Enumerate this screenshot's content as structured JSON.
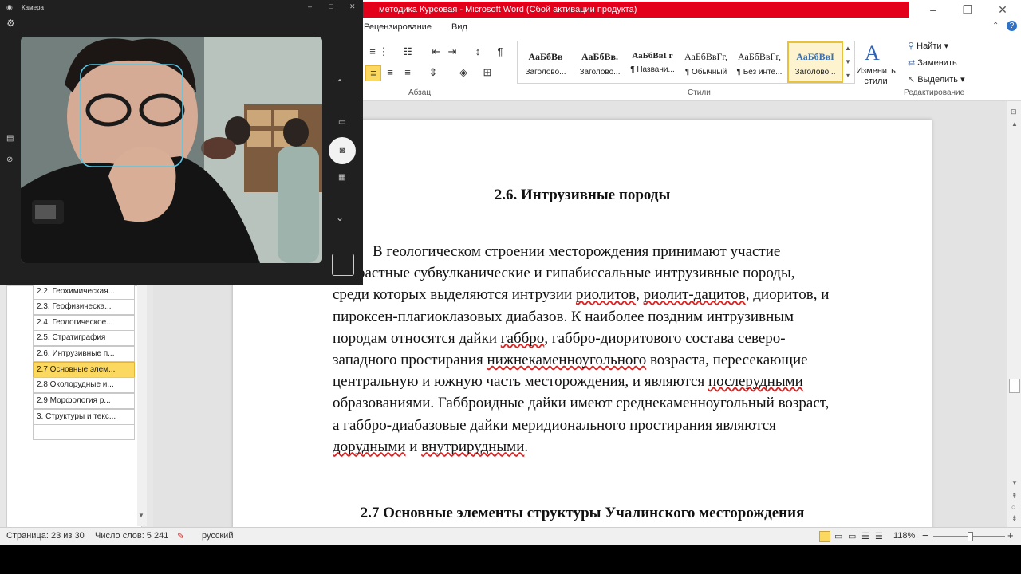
{
  "word": {
    "title": "методика Курсовая - Microsoft Word (Сбой активации продукта)",
    "window_controls": [
      "–",
      "❐",
      "✕"
    ],
    "tabs": [
      "Рецензирование",
      "Вид"
    ],
    "groups": {
      "paragraph": "Абзац",
      "styles": "Стили",
      "editing": "Редактирование"
    },
    "styles": [
      {
        "preview": "АаБбВв",
        "name": "Заголово..."
      },
      {
        "preview": "АаБбВв.",
        "name": "Заголово..."
      },
      {
        "preview": "АаБбВвГг",
        "name": "¶ Названи..."
      },
      {
        "preview": "АаБбВвГг,",
        "name": "¶ Обычный"
      },
      {
        "preview": "АаБбВвГг,",
        "name": "¶ Без инте..."
      },
      {
        "preview": "АаБбВвI",
        "name": "Заголово..."
      }
    ],
    "change_styles": "Изменить стили",
    "editing": {
      "find": "Найти",
      "replace": "Заменить",
      "select": "Выделить"
    }
  },
  "nav": {
    "items": [
      "2.2. Геохимическая...",
      "2.3. Геофизическа...",
      "2.4. Геологическое...",
      "2.5. Стратиграфия",
      "2.6. Интрузивные п...",
      "2.7 Основные элем...",
      "2.8 Околорудные и...",
      "2.9 Морфология р...",
      "3. Структуры и текс...",
      ""
    ]
  },
  "doc": {
    "heading_26": "2.6. Интрузивные породы",
    "para_lines": [
      [
        "В геологическом строении месторождения принимают участие"
      ],
      [
        "разновозрастные субвулканические и гипабиссальные интрузивные породы,"
      ],
      [
        "среди которых выделяются интрузии ",
        "риолитов",
        ", ",
        "риолит-дацитов",
        ", диоритов, и"
      ],
      [
        "пироксен-плагиоклазовых диабазов. К наиболее поздним интрузивным"
      ],
      [
        "породам относятся дайки ",
        "габбро",
        ", габбро-диоритового состава северо-"
      ],
      [
        "западного простирания ",
        "нижнекаменноугольного",
        " возраста, пересекающие"
      ],
      [
        "центральную и южную часть месторождения, и являются ",
        "послерудными"
      ],
      [
        "образованиями.  Габброидные дайки имеют среднекаменноугольный возраст,"
      ],
      [
        "а габбро-диабазовые дайки меридионального простирания являются"
      ],
      [
        "",
        "дорудными",
        " и ",
        "внутрирудными",
        "."
      ]
    ],
    "heading_27": "2.7 Основные элементы структуры Учалинского месторождения"
  },
  "status": {
    "page": "Страница: 23 из 30",
    "words": "Число слов: 5 241",
    "language": "русский",
    "zoom": "118%",
    "zoom_minus": "−",
    "zoom_plus": "+"
  },
  "camera": {
    "title": "Камера"
  }
}
